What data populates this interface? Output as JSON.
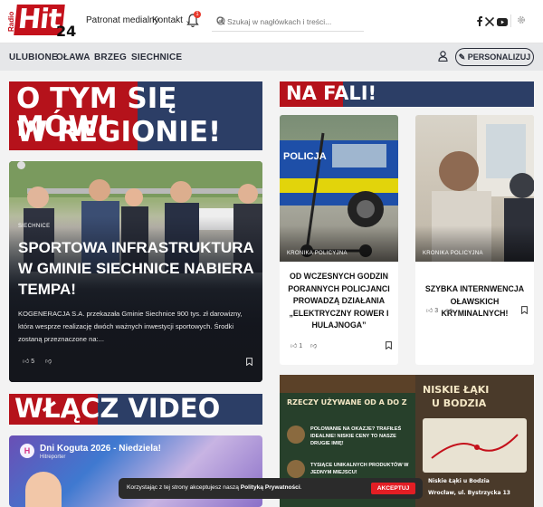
{
  "brand": {
    "radio": "Radio",
    "hit": "Hit",
    "num": "24"
  },
  "nav": {
    "patronat": "Patronat medialny",
    "kontakt": "Kontakt",
    "notif_count": "1"
  },
  "search": {
    "placeholder": "Szukaj w nagłówkach i treści..."
  },
  "menu": {
    "items": [
      "ULUBIONE",
      "OŁAWA",
      "BRZEG",
      "SIECHNICE"
    ],
    "personalize": "PERSONALIZUJ"
  },
  "sections": {
    "top_line1": "O TYM SIĘ MÓWI",
    "top_line2": "W REGIONIE!",
    "fala": "NA FALI!",
    "video": "WŁĄCZ VIDEO"
  },
  "hero": {
    "category": "SIECHNICE",
    "title": "SPORTOWA INFRASTRUKTURA W GMINIE SIECHNICE NABIERA TEMPA!",
    "excerpt": "KOGENERACJA S.A. przekazała Gminie Siechnice 900 tys. zł darowizny, która wesprze realizację dwóch ważnych inwestycji sportowych. Środki zostaną przeznaczone na:...",
    "likes": "5"
  },
  "cards": [
    {
      "title": "OD WCZESNYCH GODZIN PORANNYCH POLICJANCI PROWADZĄ DZIAŁANIA „ELEKTRYCZNY ROWER I HULAJNOGA”",
      "likes": "1",
      "car_text": "POLICJA",
      "tag": "KRONIKA POLICYJNA"
    },
    {
      "title": "SZYBKA INTERNWENCJA OŁAWSKICH KRYMINALNYCH!",
      "likes": "3",
      "tag": "KRONIKA POLICYJNA"
    }
  ],
  "video": {
    "avatar": "H",
    "title": "Dni Koguta 2026 - Niedziela!",
    "channel": "Hitreporter"
  },
  "ad": {
    "headline": "RZECZY UŻYWANE OD A DO Z",
    "bullet1": "POLOWANIE NA OKAZJE? TRAFIŁEŚ IDEALNIE! NISKIE CENY TO NASZE DRUGIE IMIĘ!",
    "bullet2": "TYSIĄCE UNIKALNYCH PRODUKTÓW W JEDNYM MIEJSCU!",
    "right_title1": "NISKIE ŁĄKI",
    "right_title2": "U BODZIA",
    "place": "Niskie Łąki u Bodzia",
    "address": "Wrocław, ul. Bystrzycka 13"
  },
  "cookie": {
    "text": "Korzystając z tej strony akceptujesz naszą ",
    "policy": "Polityką Prywatności",
    "accept": "AKCEPTUJ"
  }
}
